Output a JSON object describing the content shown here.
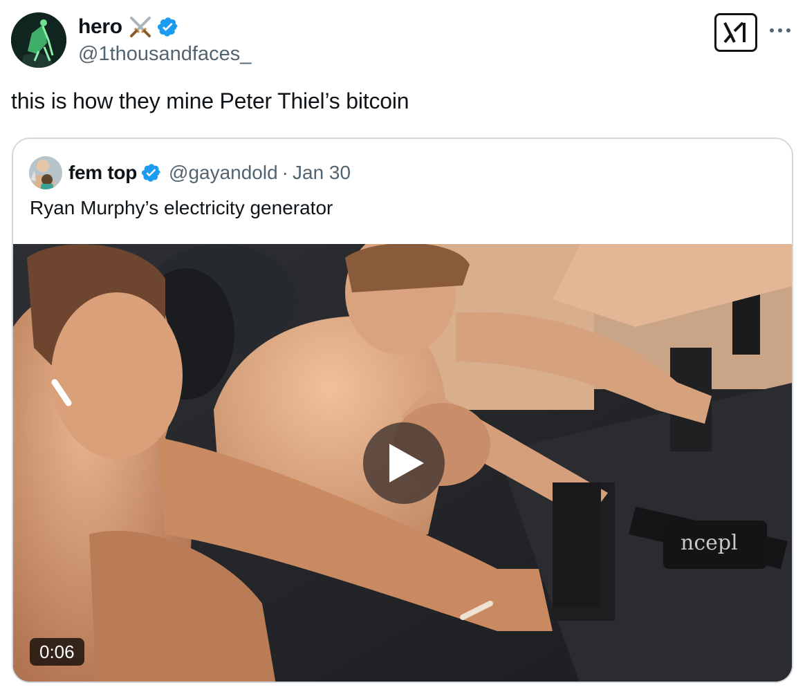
{
  "author": {
    "display_name": "hero",
    "handle": "@1thousandfaces_",
    "emoji": "crossed-swords-icon",
    "verified": true
  },
  "tweet": {
    "text": "this is how they mine Peter Thiel’s bitcoin"
  },
  "header_icons": [
    "x-grok-icon",
    "more-icon"
  ],
  "quoted_tweet": {
    "display_name": "fem top",
    "handle": "@gayandold",
    "separator": "·",
    "date": "Jan 30",
    "verified": true,
    "text": "Ryan Murphy’s electricity generator",
    "media": {
      "type": "video",
      "duration": "0:06",
      "machine_text": "ncepl"
    }
  },
  "colors": {
    "text_primary": "#0f1419",
    "text_secondary": "#536471",
    "verified_blue": "#1d9bf0",
    "border": "#cfd9de"
  }
}
